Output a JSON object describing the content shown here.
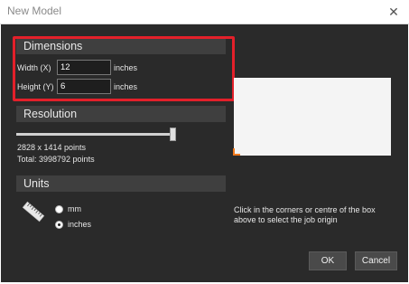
{
  "window": {
    "title": "New Model",
    "close_icon": "close-icon"
  },
  "dimensions": {
    "header": "Dimensions",
    "width_label": "Width (X)",
    "width_value": "12",
    "width_unit": "inches",
    "height_label": "Height (Y)",
    "height_value": "6",
    "height_unit": "inches"
  },
  "resolution": {
    "header": "Resolution",
    "slider_level": 0.97,
    "points_text": "2828 x 1414 points",
    "total_text": "Total: 3998792 points"
  },
  "units": {
    "header": "Units",
    "icon": "ruler-icon",
    "options": [
      {
        "label": "mm",
        "selected": false
      },
      {
        "label": "inches",
        "selected": true
      }
    ]
  },
  "origin": {
    "hint_line1": "Click in the corners or centre of the box",
    "hint_line2": "above to select the job origin",
    "accent": "#f07a1e"
  },
  "buttons": {
    "ok": "OK",
    "cancel": "Cancel"
  },
  "colors": {
    "background": "#2a2a2a",
    "highlight": "#e3202a"
  }
}
